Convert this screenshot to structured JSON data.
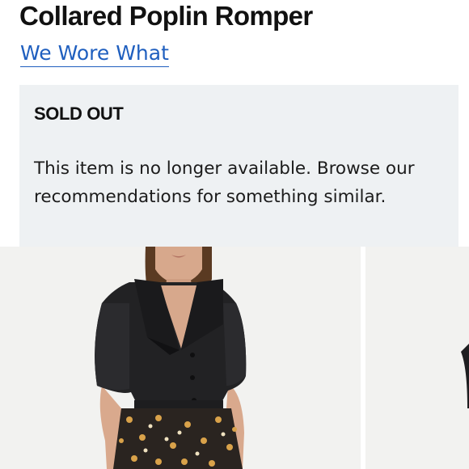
{
  "product": {
    "title": "Collared Poplin Romper",
    "brand": "We Wore What"
  },
  "availability": {
    "status": "SOLD OUT",
    "message": "This item is no longer available. Browse our recommendations for something similar."
  },
  "gallery": {
    "images": [
      {
        "subject": "model-wearing-black-collared-poplin-top-with-floral-bottom"
      },
      {
        "subject": "next-product-image-partial"
      }
    ]
  },
  "colors": {
    "brand_link": "#1f5fbf",
    "notice_background": "#eef1f3",
    "photo_background": "#f2f2f0"
  }
}
